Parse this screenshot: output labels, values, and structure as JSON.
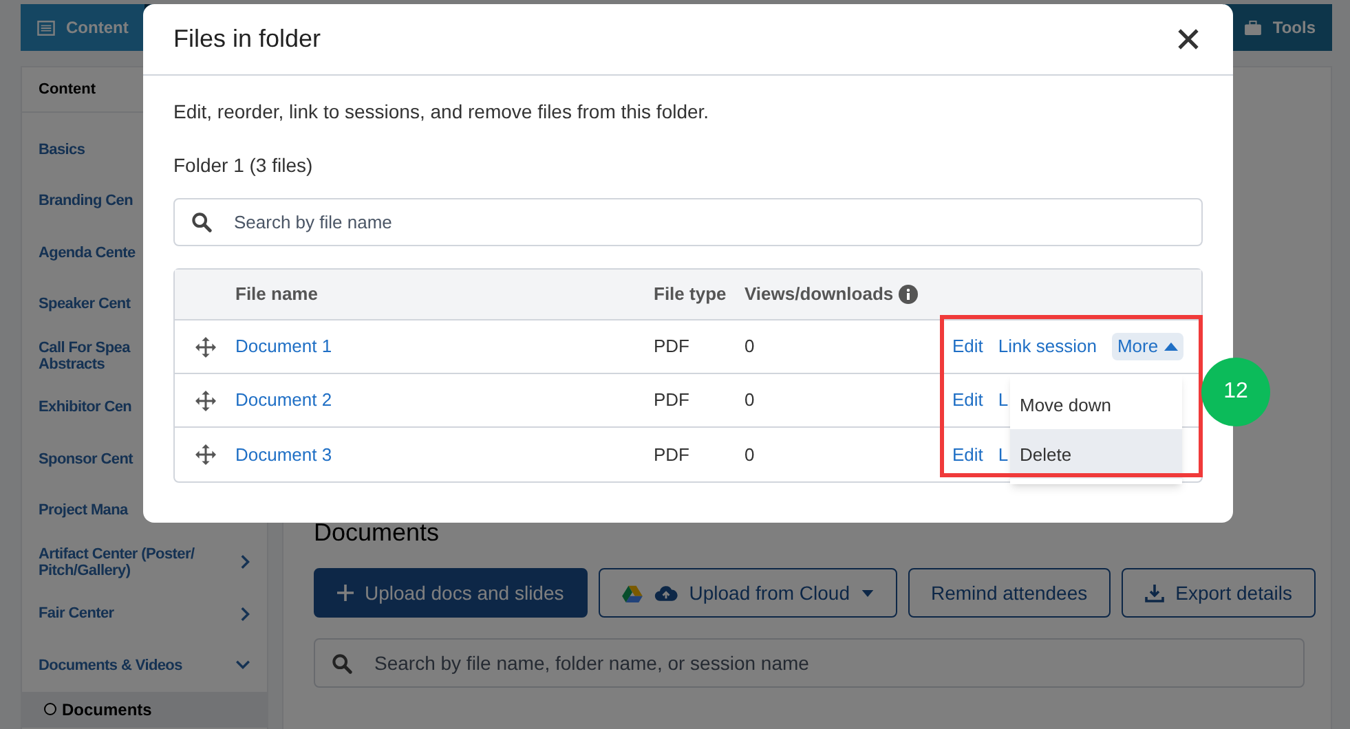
{
  "top_bar": {
    "tabs": [
      {
        "label": "Content",
        "selected": true
      },
      {
        "label": "Tools",
        "selected": false
      }
    ]
  },
  "sidebar": {
    "header": "Content",
    "items": [
      {
        "label": "Basics",
        "kind": "link"
      },
      {
        "label": "Branding Cen",
        "kind": "link"
      },
      {
        "label": "Agenda Cente",
        "kind": "link"
      },
      {
        "label": "Speaker Cent",
        "kind": "link"
      },
      {
        "label": "Call For Spea\nAbstracts",
        "kind": "link"
      },
      {
        "label": "Exhibitor Cen",
        "kind": "link"
      },
      {
        "label": "Sponsor Cent",
        "kind": "link"
      },
      {
        "label": "Project Mana",
        "kind": "link"
      },
      {
        "label": "Artifact Center (Poster/\nPitch/Gallery)",
        "kind": "collapsible",
        "expanded": false
      },
      {
        "label": "Fair Center",
        "kind": "collapsible",
        "expanded": false
      },
      {
        "label": "Documents & Videos",
        "kind": "collapsible",
        "expanded": true,
        "children": [
          {
            "label": "Documents",
            "selected": true
          }
        ]
      }
    ]
  },
  "main": {
    "heading": "Documents",
    "buttons": [
      {
        "label": "Upload docs and slides",
        "kind": "primary"
      },
      {
        "label": "Upload from Cloud",
        "kind": "cloud"
      },
      {
        "label": "Remind attendees",
        "kind": "outline"
      },
      {
        "label": "Export details",
        "kind": "export"
      }
    ],
    "search": {
      "placeholder": "Search by file name, folder name, or session name"
    }
  },
  "modal": {
    "title": "Files in folder",
    "description": "Edit, reorder, link to sessions, and remove files from this folder.",
    "folder_label": "Folder 1 (3 files)",
    "search": {
      "placeholder": "Search by file name"
    },
    "table": {
      "columns": [
        "File name",
        "File type",
        "Views/downloads"
      ],
      "rows": [
        {
          "name": "Document 1",
          "type": "PDF",
          "views": "0",
          "actions": [
            "Edit",
            "Link session"
          ],
          "more": {
            "label": "More",
            "expanded": true,
            "menu": [
              {
                "label": "Move down",
                "selected": false
              },
              {
                "label": "Delete",
                "selected": true
              }
            ]
          }
        },
        {
          "name": "Document 2",
          "type": "PDF",
          "views": "0",
          "actions": [
            "Edit",
            "L"
          ]
        },
        {
          "name": "Document 3",
          "type": "PDF",
          "views": "0",
          "actions": [
            "Edit",
            "L"
          ]
        }
      ]
    }
  },
  "annotation": {
    "label": "12"
  }
}
